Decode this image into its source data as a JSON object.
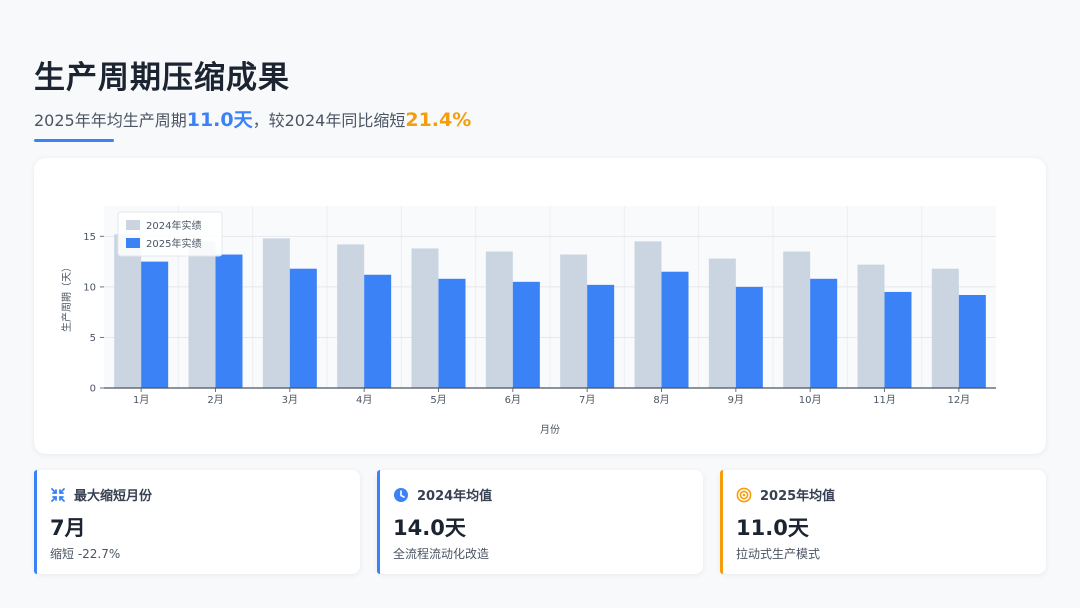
{
  "header": {
    "title": "生产周期压缩成果",
    "subtitle_prefix": "2025年年均生产周期",
    "subtitle_value1": "11.0天",
    "subtitle_mid": "，较2024年同比缩短",
    "subtitle_value2": "21.4%"
  },
  "chart_data": {
    "type": "bar",
    "categories": [
      "1月",
      "2月",
      "3月",
      "4月",
      "5月",
      "6月",
      "7月",
      "8月",
      "9月",
      "10月",
      "11月",
      "12月"
    ],
    "series": [
      {
        "name": "2024年实绩",
        "color": "#cbd5e1",
        "values": [
          15.2,
          14.5,
          14.8,
          14.2,
          13.8,
          13.5,
          13.2,
          14.5,
          12.8,
          13.5,
          12.2,
          11.8
        ]
      },
      {
        "name": "2025年实绩",
        "color": "#3b82f6",
        "values": [
          12.5,
          13.2,
          11.8,
          11.2,
          10.8,
          10.5,
          10.2,
          11.5,
          10.0,
          10.8,
          9.5,
          9.2
        ]
      }
    ],
    "xlabel": "月份",
    "ylabel": "生产周期（天）",
    "ylim": [
      0,
      18
    ],
    "yticks": [
      0,
      5,
      10,
      15
    ],
    "legend_position": "top-left",
    "grid": true
  },
  "kpis": [
    {
      "label": "最大缩短月份",
      "value": "7月",
      "note": "缩短 -22.7%",
      "accent": "#3b82f6",
      "icon": "compress-arrows-icon"
    },
    {
      "label": "2024年均值",
      "value": "14.0天",
      "note": "全流程流动化改造",
      "accent": "#3b82f6",
      "icon": "clock-icon"
    },
    {
      "label": "2025年均值",
      "value": "11.0天",
      "note": "拉动式生产模式",
      "accent": "#f59e0b",
      "icon": "target-icon"
    }
  ]
}
